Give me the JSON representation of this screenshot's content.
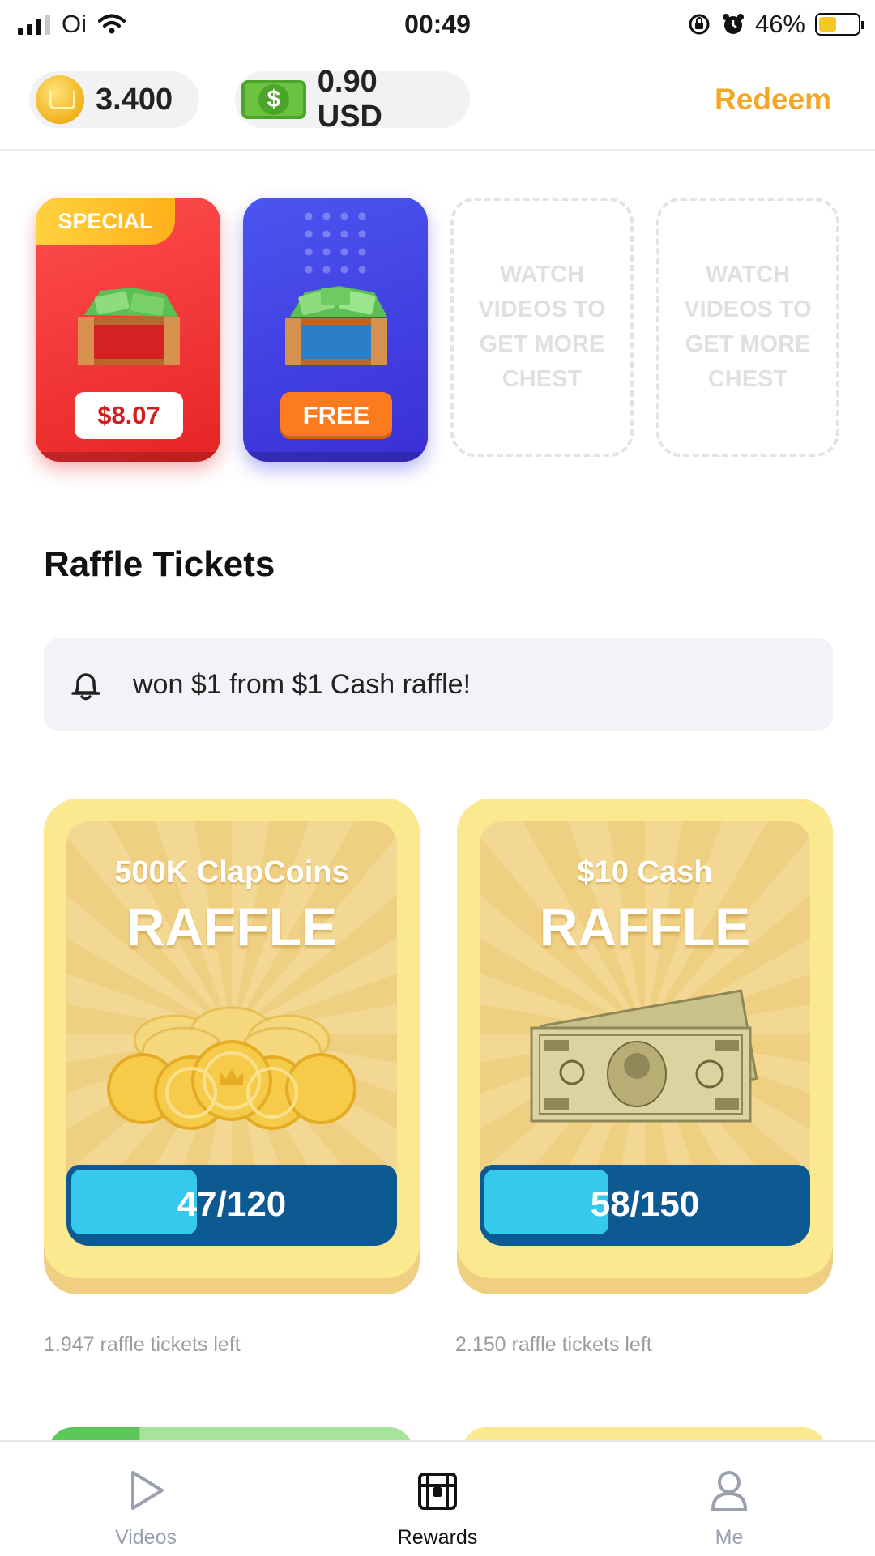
{
  "status_bar": {
    "carrier": "Oi",
    "time": "00:49",
    "battery_percent": "46%",
    "battery_level": 0.46
  },
  "header": {
    "coins": "3.400",
    "cash": "0.90 USD",
    "redeem_label": "Redeem",
    "coin_icon": "coin-icon",
    "cash_icon": "cash-icon",
    "accent_color": "#f5a623"
  },
  "chests": {
    "special": {
      "tag": "SPECIAL",
      "price": "$8.07",
      "color": "#e62424"
    },
    "free": {
      "button": "FREE",
      "color": "#3a2fd6"
    },
    "empty_slots": [
      "WATCH VIDEOS TO GET MORE CHEST",
      "WATCH VIDEOS TO GET MORE CHEST"
    ]
  },
  "raffle_section": {
    "title": "Raffle Tickets",
    "notice": "won $1 from $1 Cash raffle!",
    "cards": [
      {
        "subtitle": "500K ClapCoins",
        "title": "RAFFLE",
        "progress_label": "47/120",
        "progress": 0.3917,
        "tickets_left": "1.947 raffle tickets left",
        "prize_icon": "coins-pile-icon"
      },
      {
        "subtitle": "$10 Cash",
        "title": "RAFFLE",
        "progress_label": "58/150",
        "progress": 0.3867,
        "tickets_left": "2.150 raffle tickets left",
        "prize_icon": "ten-dollar-bill-icon"
      }
    ]
  },
  "tab_bar": {
    "items": [
      {
        "label": "Videos",
        "icon": "play-icon",
        "active": false
      },
      {
        "label": "Rewards",
        "icon": "chest-icon",
        "active": true
      },
      {
        "label": "Me",
        "icon": "person-icon",
        "active": false
      }
    ]
  }
}
